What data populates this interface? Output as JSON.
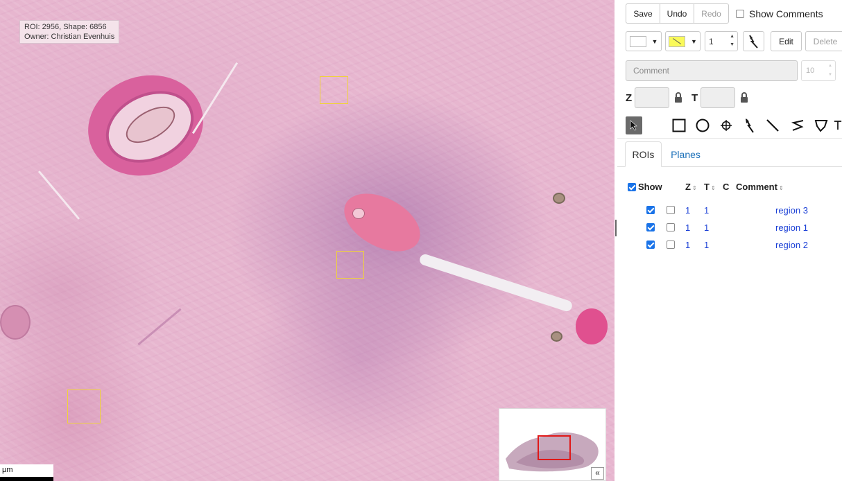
{
  "viewer": {
    "tooltip": {
      "line1": "ROI: 2956, Shape: 6856",
      "line2": "Owner: Christian Evenhuis"
    },
    "scale_unit": "µm",
    "collapse_label": "«"
  },
  "toolbar": {
    "save_label": "Save",
    "undo_label": "Undo",
    "redo_label": "Redo",
    "show_comments_label": "Show Comments",
    "stroke_color": "#ffffff",
    "fill_color": "#fafa5a",
    "stroke_width_value": "1",
    "edit_label": "Edit",
    "delete_label": "Delete",
    "comment_placeholder": "Comment",
    "font_size_value": "10",
    "z_label": "Z",
    "t_label": "T"
  },
  "tools": [
    "pointer-icon",
    "rectangle-icon",
    "ellipse-icon",
    "point-icon",
    "arrow-icon",
    "line-icon",
    "polyline-icon",
    "polygon-icon",
    "text-icon"
  ],
  "tabs": [
    {
      "label": "ROIs"
    },
    {
      "label": "Planes"
    }
  ],
  "table": {
    "headers": {
      "show": "Show",
      "z": "Z",
      "t": "T",
      "c": "C",
      "comment": "Comment"
    },
    "rows": [
      {
        "z": "1",
        "t": "1",
        "comment": "region 3"
      },
      {
        "z": "1",
        "t": "1",
        "comment": "region 1"
      },
      {
        "z": "1",
        "t": "1",
        "comment": "region 2"
      }
    ]
  }
}
